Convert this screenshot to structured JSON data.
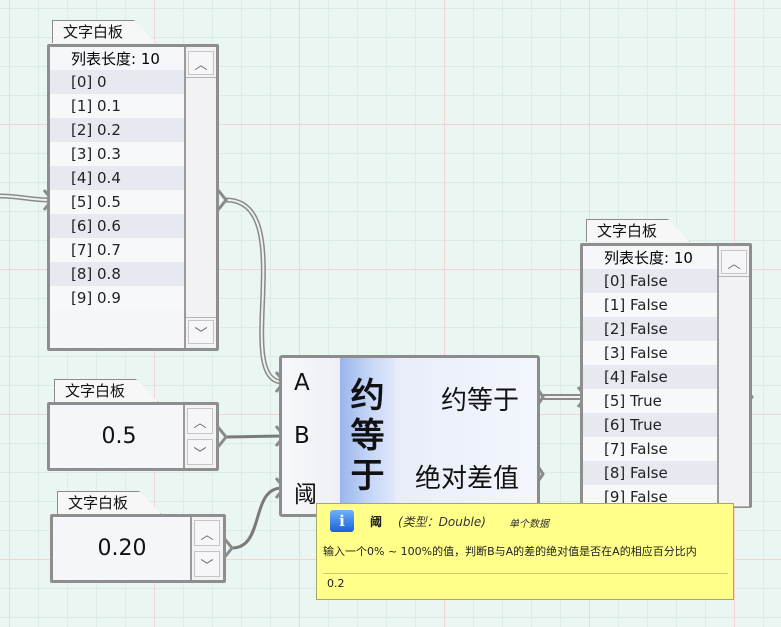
{
  "panels": {
    "list_a": {
      "tab": "文字白板",
      "length_label": "列表长度: 10",
      "rows": [
        "[0] 0",
        "[1] 0.1",
        "[2] 0.2",
        "[3] 0.3",
        "[4] 0.4",
        "[5] 0.5",
        "[6] 0.6",
        "[7] 0.7",
        "[8] 0.8",
        "[9] 0.9"
      ]
    },
    "value_b": {
      "tab": "文字白板",
      "value": "0.5"
    },
    "value_threshold": {
      "tab": "文字白板",
      "value": "0.20"
    },
    "list_result": {
      "tab": "文字白板",
      "length_label": "列表长度: 10",
      "rows": [
        "[0] False",
        "[1] False",
        "[2] False",
        "[3] False",
        "[4] False",
        "[5] True",
        "[6] True",
        "[7] False",
        "[8] False",
        "[9] False"
      ]
    }
  },
  "component": {
    "inputs": [
      "A",
      "B",
      "阈"
    ],
    "name_chars": [
      "约",
      "等",
      "于"
    ],
    "outputs": [
      "约等于",
      "绝对差值"
    ]
  },
  "tooltip": {
    "icon": "info-icon",
    "icon_glyph": "i",
    "title": "阈",
    "type": "(类型：Double)",
    "access": "单个数据",
    "description": "输入一个0% ~ 100%的值，判断B与A的差的绝对值是否在A的相应百分比内",
    "value": "0.2"
  },
  "icons": {
    "scroll_up": "chevron-up-icon",
    "scroll_down": "chevron-down-icon",
    "glyph_up": "︿",
    "glyph_down": "﹀"
  },
  "colors": {
    "canvas": "#eaf6f2",
    "component_accent": "#9ab5ee",
    "tooltip_bg": "#ffff8a"
  }
}
